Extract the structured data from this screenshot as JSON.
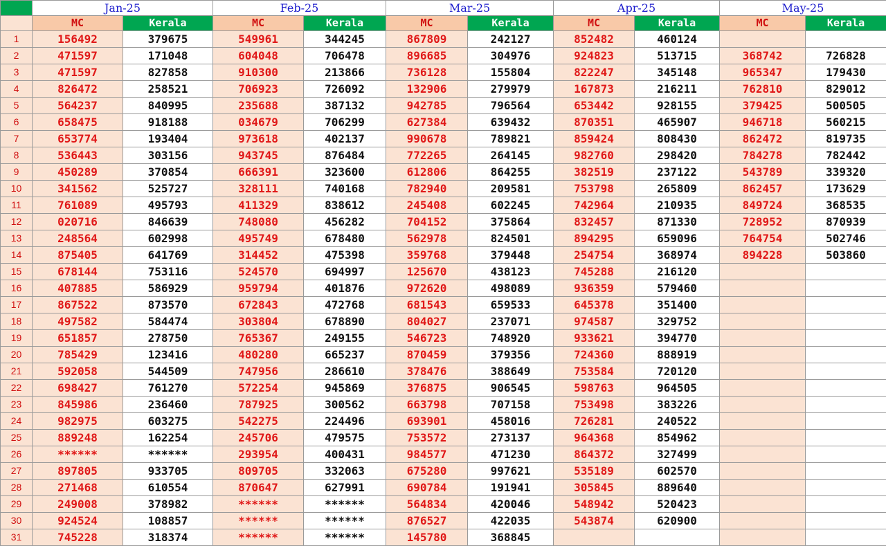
{
  "months": [
    "Jan-25",
    "Feb-25",
    "Mar-25",
    "Apr-25",
    "May-25"
  ],
  "labels": {
    "mc": "MC",
    "kerala": "Kerala"
  },
  "colors": {
    "header_green": "#00a651",
    "mc_bg": "#fbe3d3",
    "mc_text": "#e01818",
    "month_text": "#1a1acc"
  },
  "rows": [
    {
      "n": "1",
      "c": [
        [
          "156492",
          "379675"
        ],
        [
          "549961",
          "344245"
        ],
        [
          "867809",
          "242127"
        ],
        [
          "852482",
          "460124"
        ],
        [
          "",
          ""
        ]
      ]
    },
    {
      "n": "2",
      "c": [
        [
          "471597",
          "171048"
        ],
        [
          "604048",
          "706478"
        ],
        [
          "896685",
          "304976"
        ],
        [
          "924823",
          "513715"
        ],
        [
          "368742",
          "726828"
        ]
      ]
    },
    {
      "n": "3",
      "c": [
        [
          "471597",
          "827858"
        ],
        [
          "910300",
          "213866"
        ],
        [
          "736128",
          "155804"
        ],
        [
          "822247",
          "345148"
        ],
        [
          "965347",
          "179430"
        ]
      ]
    },
    {
      "n": "4",
      "c": [
        [
          "826472",
          "258521"
        ],
        [
          "706923",
          "726092"
        ],
        [
          "132906",
          "279979"
        ],
        [
          "167873",
          "216211"
        ],
        [
          "762810",
          "829012"
        ]
      ]
    },
    {
      "n": "5",
      "c": [
        [
          "564237",
          "840995"
        ],
        [
          "235688",
          "387132"
        ],
        [
          "942785",
          "796564"
        ],
        [
          "653442",
          "928155"
        ],
        [
          "379425",
          "500505"
        ]
      ]
    },
    {
      "n": "6",
      "c": [
        [
          "658475",
          "918188"
        ],
        [
          "034679",
          "706299"
        ],
        [
          "627384",
          "639432"
        ],
        [
          "870351",
          "465907"
        ],
        [
          "946718",
          "560215"
        ]
      ]
    },
    {
      "n": "7",
      "c": [
        [
          "653774",
          "193404"
        ],
        [
          "973618",
          "402137"
        ],
        [
          "990678",
          "789821"
        ],
        [
          "859424",
          "808430"
        ],
        [
          "862472",
          "819735"
        ]
      ]
    },
    {
      "n": "8",
      "c": [
        [
          "536443",
          "303156"
        ],
        [
          "943745",
          "876484"
        ],
        [
          "772265",
          "264145"
        ],
        [
          "982760",
          "298420"
        ],
        [
          "784278",
          "782442"
        ]
      ]
    },
    {
      "n": "9",
      "c": [
        [
          "450289",
          "370854"
        ],
        [
          "666391",
          "323600"
        ],
        [
          "612806",
          "864255"
        ],
        [
          "382519",
          "237122"
        ],
        [
          "543789",
          "339320"
        ]
      ]
    },
    {
      "n": "10",
      "c": [
        [
          "341562",
          "525727"
        ],
        [
          "328111",
          "740168"
        ],
        [
          "782940",
          "209581"
        ],
        [
          "753798",
          "265809"
        ],
        [
          "862457",
          "173629"
        ]
      ]
    },
    {
      "n": "11",
      "c": [
        [
          "761089",
          "495793"
        ],
        [
          "411329",
          "838612"
        ],
        [
          "245408",
          "602245"
        ],
        [
          "742964",
          "210935"
        ],
        [
          "849724",
          "368535"
        ]
      ]
    },
    {
      "n": "12",
      "c": [
        [
          "020716",
          "846639"
        ],
        [
          "748080",
          "456282"
        ],
        [
          "704152",
          "375864"
        ],
        [
          "832457",
          "871330"
        ],
        [
          "728952",
          "870939"
        ]
      ]
    },
    {
      "n": "13",
      "c": [
        [
          "248564",
          "602998"
        ],
        [
          "495749",
          "678480"
        ],
        [
          "562978",
          "824501"
        ],
        [
          "894295",
          "659096"
        ],
        [
          "764754",
          "502746"
        ]
      ]
    },
    {
      "n": "14",
      "c": [
        [
          "875405",
          "641769"
        ],
        [
          "314452",
          "475398"
        ],
        [
          "359768",
          "379448"
        ],
        [
          "254754",
          "368974"
        ],
        [
          "894228",
          "503860"
        ]
      ]
    },
    {
      "n": "15",
      "c": [
        [
          "678144",
          "753116"
        ],
        [
          "524570",
          "694997"
        ],
        [
          "125670",
          "438123"
        ],
        [
          "745288",
          "216120"
        ],
        [
          "",
          ""
        ]
      ]
    },
    {
      "n": "16",
      "c": [
        [
          "407885",
          "586929"
        ],
        [
          "959794",
          "401876"
        ],
        [
          "972620",
          "498089"
        ],
        [
          "936359",
          "579460"
        ],
        [
          "",
          ""
        ]
      ]
    },
    {
      "n": "17",
      "c": [
        [
          "867522",
          "873570"
        ],
        [
          "672843",
          "472768"
        ],
        [
          "681543",
          "659533"
        ],
        [
          "645378",
          "351400"
        ],
        [
          "",
          ""
        ]
      ]
    },
    {
      "n": "18",
      "c": [
        [
          "497582",
          "584474"
        ],
        [
          "303804",
          "678890"
        ],
        [
          "804027",
          "237071"
        ],
        [
          "974587",
          "329752"
        ],
        [
          "",
          ""
        ]
      ]
    },
    {
      "n": "19",
      "c": [
        [
          "651857",
          "278750"
        ],
        [
          "765367",
          "249155"
        ],
        [
          "546723",
          "748920"
        ],
        [
          "933621",
          "394770"
        ],
        [
          "",
          ""
        ]
      ]
    },
    {
      "n": "20",
      "c": [
        [
          "785429",
          "123416"
        ],
        [
          "480280",
          "665237"
        ],
        [
          "870459",
          "379356"
        ],
        [
          "724360",
          "888919"
        ],
        [
          "",
          ""
        ]
      ]
    },
    {
      "n": "21",
      "c": [
        [
          "592058",
          "544509"
        ],
        [
          "747956",
          "286610"
        ],
        [
          "378476",
          "388649"
        ],
        [
          "753584",
          "720120"
        ],
        [
          "",
          ""
        ]
      ]
    },
    {
      "n": "22",
      "c": [
        [
          "698427",
          "761270"
        ],
        [
          "572254",
          "945869"
        ],
        [
          "376875",
          "906545"
        ],
        [
          "598763",
          "964505"
        ],
        [
          "",
          ""
        ]
      ]
    },
    {
      "n": "23",
      "c": [
        [
          "845986",
          "236460"
        ],
        [
          "787925",
          "300562"
        ],
        [
          "663798",
          "707158"
        ],
        [
          "753498",
          "383226"
        ],
        [
          "",
          ""
        ]
      ]
    },
    {
      "n": "24",
      "c": [
        [
          "982975",
          "603275"
        ],
        [
          "542275",
          "224496"
        ],
        [
          "693901",
          "458016"
        ],
        [
          "726281",
          "240522"
        ],
        [
          "",
          ""
        ]
      ]
    },
    {
      "n": "25",
      "c": [
        [
          "889248",
          "162254"
        ],
        [
          "245706",
          "479575"
        ],
        [
          "753572",
          "273137"
        ],
        [
          "964368",
          "854962"
        ],
        [
          "",
          ""
        ]
      ]
    },
    {
      "n": "26",
      "c": [
        [
          "******",
          "******"
        ],
        [
          "293954",
          "400431"
        ],
        [
          "984577",
          "471230"
        ],
        [
          "864372",
          "327499"
        ],
        [
          "",
          ""
        ]
      ]
    },
    {
      "n": "27",
      "c": [
        [
          "897805",
          "933705"
        ],
        [
          "809705",
          "332063"
        ],
        [
          "675280",
          "997621"
        ],
        [
          "535189",
          "602570"
        ],
        [
          "",
          ""
        ]
      ]
    },
    {
      "n": "28",
      "c": [
        [
          "271468",
          "610554"
        ],
        [
          "870647",
          "627991"
        ],
        [
          "690784",
          "191941"
        ],
        [
          "305845",
          "889640"
        ],
        [
          "",
          ""
        ]
      ]
    },
    {
      "n": "29",
      "c": [
        [
          "249008",
          "378982"
        ],
        [
          "******",
          "******"
        ],
        [
          "564834",
          "420046"
        ],
        [
          "548942",
          "520423"
        ],
        [
          "",
          ""
        ]
      ]
    },
    {
      "n": "30",
      "c": [
        [
          "924524",
          "108857"
        ],
        [
          "******",
          "******"
        ],
        [
          "876527",
          "422035"
        ],
        [
          "543874",
          "620900"
        ],
        [
          "",
          ""
        ]
      ]
    },
    {
      "n": "31",
      "c": [
        [
          "745228",
          "318374"
        ],
        [
          "******",
          "******"
        ],
        [
          "145780",
          "368845"
        ],
        [
          "",
          ""
        ],
        [
          "",
          ""
        ]
      ]
    }
  ]
}
